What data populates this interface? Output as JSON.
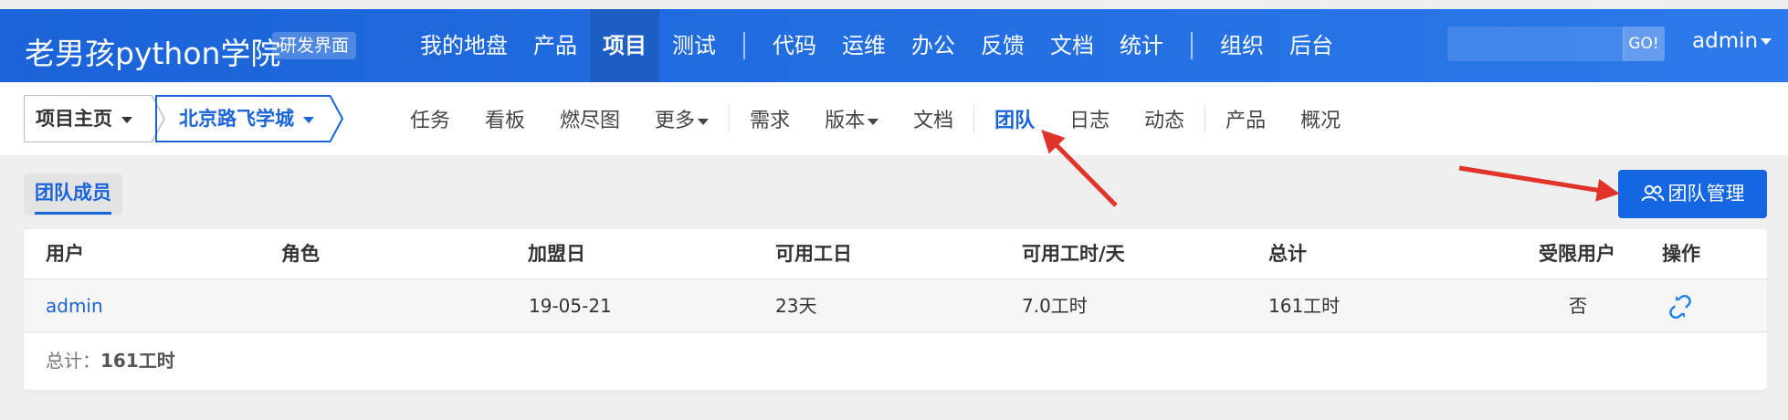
{
  "brand": {
    "title": "老男孩python学院",
    "tag": "研发界面"
  },
  "main_nav": [
    {
      "label": "我的地盘"
    },
    {
      "label": "产品"
    },
    {
      "label": "项目"
    },
    {
      "label": "测试"
    },
    {
      "label": "代码"
    },
    {
      "label": "运维"
    },
    {
      "label": "办公"
    },
    {
      "label": "反馈"
    },
    {
      "label": "文档"
    },
    {
      "label": "统计"
    },
    {
      "label": "组织"
    },
    {
      "label": "后台"
    }
  ],
  "search": {
    "placeholder": "",
    "go_label": "GO!"
  },
  "user": {
    "name": "admin"
  },
  "breadcrumb": {
    "home": "项目主页",
    "project": "北京路飞学城"
  },
  "sub_nav": [
    {
      "label": "任务"
    },
    {
      "label": "看板"
    },
    {
      "label": "燃尽图"
    },
    {
      "label": "更多"
    },
    {
      "label": "需求"
    },
    {
      "label": "版本"
    },
    {
      "label": "文档"
    },
    {
      "label": "团队"
    },
    {
      "label": "日志"
    },
    {
      "label": "动态"
    },
    {
      "label": "产品"
    },
    {
      "label": "概况"
    }
  ],
  "section": {
    "tab": "团队成员",
    "manage_button": "团队管理"
  },
  "table": {
    "headers": [
      "用户",
      "角色",
      "加盟日",
      "可用工日",
      "可用工时/天",
      "总计",
      "受限用户",
      "操作"
    ],
    "rows": [
      {
        "user": "admin",
        "role": "",
        "join_date": "19-05-21",
        "days": "23天",
        "hours_per_day": "7.0工时",
        "total": "161工时",
        "restricted": "否"
      }
    ],
    "footer_label": "总计：",
    "footer_value": "161工时"
  },
  "colors": {
    "brand_blue": "#1a63d8",
    "arrow_red": "#e0332a"
  }
}
